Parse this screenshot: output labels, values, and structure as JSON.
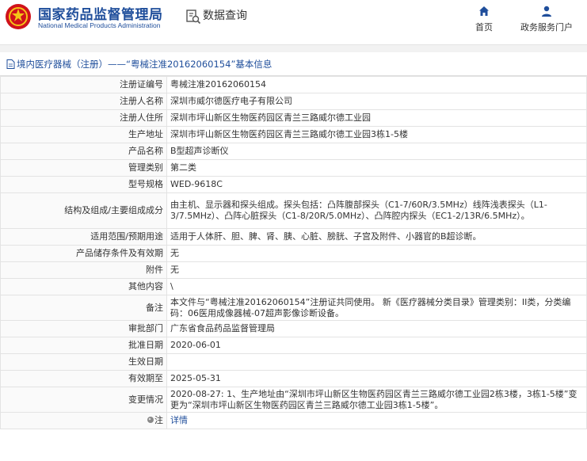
{
  "header": {
    "brand_cn": "国家药品监督管理局",
    "brand_en": "National Medical Products Administration",
    "page_heading": "数据查询",
    "nav": [
      {
        "label": "首页",
        "icon": "home-icon"
      },
      {
        "label": "政务服务门户",
        "icon": "user-icon"
      }
    ]
  },
  "breadcrumb": "境内医疗器械（注册）——“粤械注准20162060154”基本信息",
  "colors": {
    "brand": "#1f4e9b",
    "emblem_red": "#d0121b",
    "border": "#e3e3e3"
  },
  "rows": [
    {
      "label": "注册证编号",
      "value": "粤械注准20162060154"
    },
    {
      "label": "注册人名称",
      "value": "深圳市威尔德医疗电子有限公司"
    },
    {
      "label": "注册人住所",
      "value": "深圳市坪山新区生物医药园区青兰三路威尔德工业园"
    },
    {
      "label": "生产地址",
      "value": "深圳市坪山新区生物医药园区青兰三路威尔德工业园3栋1-5楼"
    },
    {
      "label": "产品名称",
      "value": "B型超声诊断仪"
    },
    {
      "label": "管理类别",
      "value": "第二类"
    },
    {
      "label": "型号规格",
      "value": "WED-9618C"
    },
    {
      "label": "结构及组成/主要组成成分",
      "value": "由主机、显示器和探头组成。探头包括：凸阵腹部探头（C1-7/60R/3.5MHz）线阵浅表探头（L1-3/7.5MHz）、凸阵心脏探头（C1-8/20R/5.0MHz）、凸阵腔内探头（EC1-2/13R/6.5MHz）。"
    },
    {
      "label": "适用范围/预期用途",
      "value": "适用于人体肝、胆、脾、肾、胰、心脏、膀胱、子宫及附件、小器官的B超诊断。"
    },
    {
      "label": "产品储存条件及有效期",
      "value": "无"
    },
    {
      "label": "附件",
      "value": "无"
    },
    {
      "label": "其他内容",
      "value": "\\"
    },
    {
      "label": "备注",
      "value": "本文件与“粤械注准20162060154”注册证共同使用。 新《医疗器械分类目录》管理类别：II类，分类编码：06医用成像器械-07超声影像诊断设备。"
    },
    {
      "label": "审批部门",
      "value": "广东省食品药品监督管理局"
    },
    {
      "label": "批准日期",
      "value": "2020-06-01"
    },
    {
      "label": "生效日期",
      "value": ""
    },
    {
      "label": "有效期至",
      "value": "2025-05-31"
    },
    {
      "label": "变更情况",
      "value": "2020-08-27: 1、生产地址由“深圳市坪山新区生物医药园区青兰三路威尔德工业园2栋3楼，3栋1-5楼”变更为“深圳市坪山新区生物医药园区青兰三路威尔德工业园3栋1-5楼”。"
    },
    {
      "label": "注",
      "value": "详情"
    }
  ]
}
